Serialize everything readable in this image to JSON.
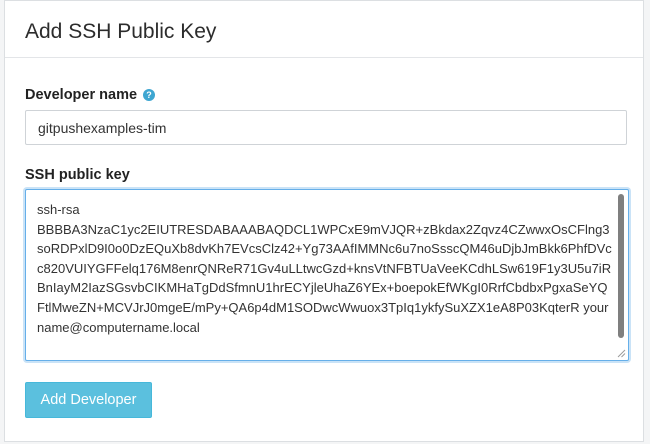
{
  "panel": {
    "title": "Add SSH Public Key"
  },
  "developer_name": {
    "label": "Developer name",
    "help_icon": "?",
    "value": "gitpushexamples-tim"
  },
  "ssh_key": {
    "label": "SSH public key",
    "value": "ssh-rsa\nBBBBA3NzaC1yc2EIUTRESDABAAABAQDCL1WPCxE9mVJQR+zBkdax2Zqvz4CZwwxOsCFlng3soRDPxlD9I0o0DzEQuXb8dvKh7EVcsClz42+Yg73AAfIMMNc6u7noSsscQM46uDjbJmBkk6PhfDVcc820VUIYGFFelq176M8enrQNReR71Gv4uLLtwcGzd+knsVtNFBTUaVeeKCdhLSw619F1y3U5u7iRBnIayM2IazSGsvbCIKMHaTgDdSfmnU1hrECYjleUhaZ6YEx+boepokEfWKgI0RrfCbdbxPgxaSeYQFtlMweZN+MCVJrJ0mgeE/mPy+QA6p4dM1SODwcWwuox3TpIq1ykfySuXZX1eA8P03KqterR yourname@computername.local"
  },
  "actions": {
    "add_label": "Add Developer"
  },
  "colors": {
    "button": "#5bc0de",
    "help_icon": "#3ea6d1",
    "focus_border": "#66afe9"
  }
}
